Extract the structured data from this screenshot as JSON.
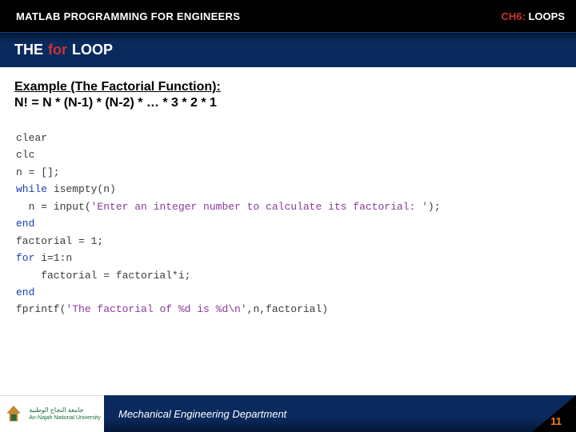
{
  "header": {
    "left": "MATLAB PROGRAMMING FOR ENGINEERS",
    "right_prefix": "CH6:",
    "right_suffix": "LOOPS"
  },
  "subheader": {
    "the": "THE",
    "for": "for",
    "loop": "LOOP"
  },
  "content": {
    "example_heading": "Example (The Factorial Function):",
    "formula": "N! = N * (N-1) * (N-2) * … * 3 * 2 * 1"
  },
  "code": {
    "l1": "clear",
    "l2": "clc",
    "l3": "n = [];",
    "l4a": "while",
    "l4b": " isempty(n)",
    "l5a": "  n = input(",
    "l5b": "'Enter an integer number to calculate its factorial: '",
    "l5c": ");",
    "l6": "end",
    "l7": "factorial = 1;",
    "l8a": "for",
    "l8b": " i=1:n",
    "l9": "    factorial = factorial*i;",
    "l10": "end",
    "l11a": "fprintf(",
    "l11b": "'The factorial of %d is %d\\n'",
    "l11c": ",n,factorial)"
  },
  "footer": {
    "logo_ar": "جامعة النجاح الوطنية",
    "logo_en": "An-Najah National University",
    "dept": "Mechanical Engineering Department",
    "page": "11"
  }
}
